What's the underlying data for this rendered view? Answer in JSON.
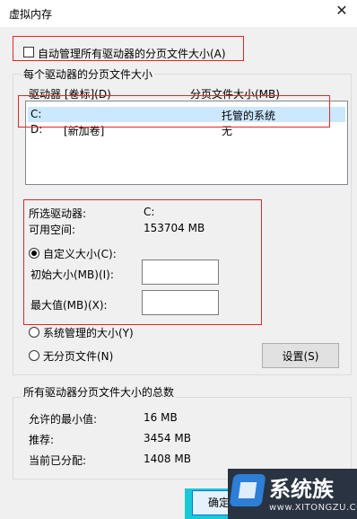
{
  "window": {
    "title": "虚拟内存",
    "close_glyph": "✕"
  },
  "auto_manage": {
    "label": "自动管理所有驱动器的分页文件大小(A)",
    "checked": false
  },
  "drives_group": {
    "title": "每个驱动器的分页文件大小",
    "col_drive": "驱动器 [卷标](D)",
    "col_size": "分页文件大小(MB)",
    "rows": [
      {
        "drive": "C:",
        "label": "",
        "size": "托管的系统",
        "selected": true
      },
      {
        "drive": "D:",
        "label": "[新加卷]",
        "size": "无",
        "selected": false
      }
    ]
  },
  "selected_drive": {
    "label": "所选驱动器:",
    "value": "C:",
    "space_label": "可用空间:",
    "space_value": "153704 MB"
  },
  "custom_size": {
    "label": "自定义大小(C):",
    "selected": true,
    "initial_label": "初始大小(MB)(I):",
    "initial_value": "",
    "max_label": "最大值(MB)(X):",
    "max_value": ""
  },
  "system_managed": {
    "label": "系统管理的大小(Y)",
    "selected": false
  },
  "no_paging": {
    "label": "无分页文件(N)",
    "selected": false
  },
  "set_button": "设置(S)",
  "total_group": {
    "title": "所有驱动器分页文件大小的总数",
    "min_label": "允许的最小值:",
    "min_value": "16 MB",
    "rec_label": "推荐:",
    "rec_value": "3454 MB",
    "cur_label": "当前已分配:",
    "cur_value": "1408 MB"
  },
  "ok_button": "确定",
  "watermark": {
    "brand": "系统族",
    "url": "www.XITONGZU.COM"
  },
  "colors": {
    "highlight_box": "#e0262a",
    "selection": "#cce8ff"
  }
}
